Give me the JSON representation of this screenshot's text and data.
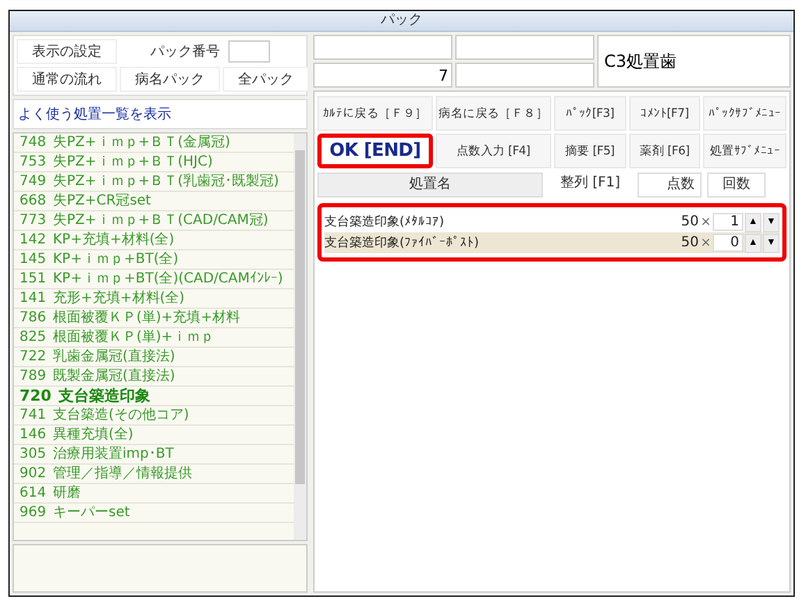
{
  "window": {
    "title": "パック"
  },
  "top_left": {
    "buttons": [
      {
        "label": "表示の設定"
      },
      {
        "label": "パック番号"
      },
      {
        "label": "通常の流れ"
      },
      {
        "label": "病名パック"
      },
      {
        "label": "全パック"
      }
    ]
  },
  "top_field_value": "7",
  "top_label": "C3処置歯",
  "list_header": "よく使う処置一覧を表示",
  "list_items": [
    {
      "code": "748",
      "name": "失PZ+ｉｍｐ+ＢＴ(金属冠)",
      "selected": false
    },
    {
      "code": "753",
      "name": "失PZ+ｉｍｐ+ＢＴ(HJC)",
      "selected": false
    },
    {
      "code": "749",
      "name": "失PZ+ｉｍｐ+ＢＴ(乳歯冠･既製冠)",
      "selected": false
    },
    {
      "code": "668",
      "name": "失PZ+CR冠set",
      "selected": false
    },
    {
      "code": "773",
      "name": "失PZ+ｉｍｐ+ＢＴ(CAD/CAM冠)",
      "selected": false
    },
    {
      "code": "142",
      "name": "KP+充填+材料(全)",
      "selected": false
    },
    {
      "code": "145",
      "name": "KP+ｉｍｐ+BT(全)",
      "selected": false
    },
    {
      "code": "151",
      "name": "KP+ｉｍｐ+BT(全)(CAD/CAMｲﾝﾚｰ)",
      "selected": false
    },
    {
      "code": "141",
      "name": "充形+充填+材料(全)",
      "selected": false
    },
    {
      "code": "786",
      "name": "根面被覆ＫＰ(単)+充填+材料",
      "selected": false
    },
    {
      "code": "825",
      "name": "根面被覆ＫＰ(単)+ｉｍｐ",
      "selected": false
    },
    {
      "code": "722",
      "name": "乳歯金属冠(直接法)",
      "selected": false
    },
    {
      "code": "789",
      "name": "既製金属冠(直接法)",
      "selected": false
    },
    {
      "code": "720",
      "name": "支台築造印象",
      "selected": true
    },
    {
      "code": "741",
      "name": "支台築造(その他コア)",
      "selected": false
    },
    {
      "code": "146",
      "name": "異種充填(全)",
      "selected": false
    },
    {
      "code": "305",
      "name": "治療用装置imp･BT",
      "selected": false
    },
    {
      "code": "902",
      "name": "管理／指導／情報提供",
      "selected": false
    },
    {
      "code": "614",
      "name": "研磨",
      "selected": false
    },
    {
      "code": "969",
      "name": "キーパーset",
      "selected": false
    }
  ],
  "action_buttons": [
    {
      "label": "ｶﾙﾃに戻る［Ｆ９］",
      "kind": "normal"
    },
    {
      "label": "病名に戻る［Ｆ８］",
      "kind": "normal"
    },
    {
      "label": "ﾊﾟｯｸ[F3]",
      "kind": "normal"
    },
    {
      "label": "ｺﾒﾝﾄ[F7]",
      "kind": "normal"
    },
    {
      "label": "ﾊﾟｯｸｻﾌﾞﾒﾆｭｰ",
      "kind": "normal"
    },
    {
      "label": "OK [END]",
      "kind": "primary"
    },
    {
      "label": "点数入力 [F4]",
      "kind": "normal"
    },
    {
      "label": "摘要 [F5]",
      "kind": "normal"
    },
    {
      "label": "薬剤 [F6]",
      "kind": "normal"
    },
    {
      "label": "処置ｻﾌﾞﾒﾆｭｰ",
      "kind": "normal"
    }
  ],
  "table": {
    "columns": [
      "処置名",
      "整列 [F1]",
      "点数",
      "回数"
    ],
    "rows": [
      {
        "name": "支台築造印象(ﾒﾀﾙｺｱ)",
        "points": "50",
        "times_sign": "×",
        "count": "1",
        "up": "▲",
        "down": "▼",
        "selected": false
      },
      {
        "name": "支台築造印象(ﾌｧｲﾊﾞｰﾎﾟｽﾄ)",
        "points": "50",
        "times_sign": "×",
        "count": "0",
        "up": "▲",
        "down": "▼",
        "selected": true
      }
    ]
  }
}
